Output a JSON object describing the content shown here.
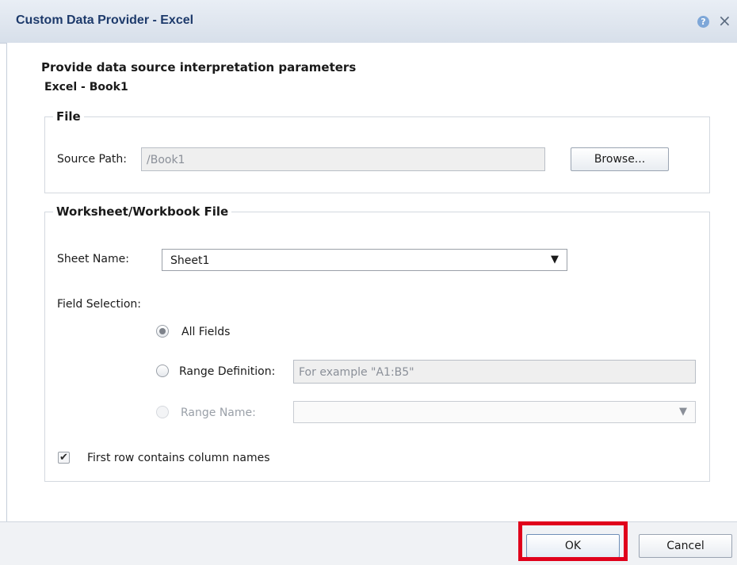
{
  "dialog": {
    "title": "Custom Data Provider - Excel",
    "help_icon": "?",
    "close_icon": "×"
  },
  "header": {
    "heading": "Provide data source interpretation parameters",
    "subheading": "Excel -   Book1"
  },
  "file_section": {
    "legend": "File",
    "source_path_label": "Source Path:",
    "source_path_value": "/Book1",
    "browse_label": "Browse..."
  },
  "worksheet_section": {
    "legend": "Worksheet/Workbook File",
    "sheet_name_label": "Sheet Name:",
    "sheet_name_value": "Sheet1",
    "field_selection_label": "Field Selection:",
    "options": {
      "all_fields": "All Fields",
      "range_definition": "Range Definition:",
      "range_name": "Range Name:"
    },
    "range_definition_placeholder": "For example \"A1:B5\"",
    "range_name_value": "",
    "first_row_label": "First row contains column names"
  },
  "footer": {
    "ok_label": "OK",
    "cancel_label": "Cancel"
  },
  "icons": {
    "dropdown_arrow": "▼",
    "checkmark": "✔"
  },
  "colors": {
    "title_text": "#1d3a6b",
    "highlight": "#e0001b"
  }
}
